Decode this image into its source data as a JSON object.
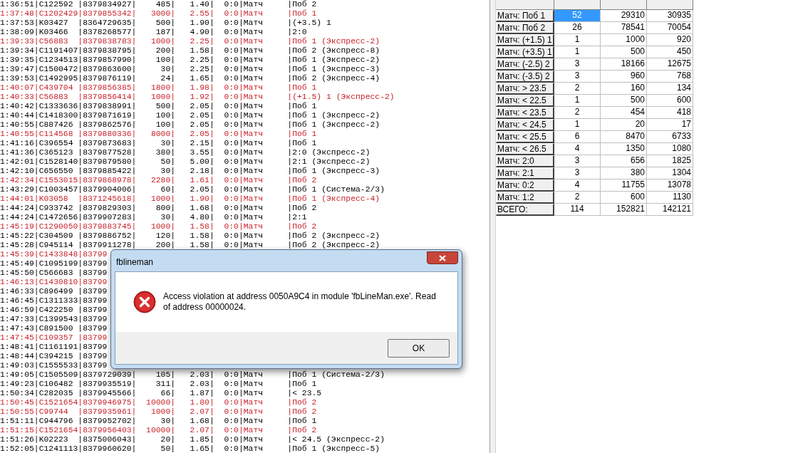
{
  "log": {
    "rows": [
      {
        "line": "1:36:51|C122592 |8379834927|    485|   1.40|  0:0|Матч     |Поб 2",
        "highlighted": false
      },
      {
        "line": "1:37:48|C1202429|8379855342|   3000|   2.55|  0:0|Матч     |Поб 1",
        "highlighted": true
      },
      {
        "line": "1:37:53|K03427  |8364729635|    500|   1.90|  0:0|Матч     |(+3.5) 1",
        "highlighted": false
      },
      {
        "line": "1:38:09|K03466  |8378268577|    187|   4.90|  0:0|Матч     |2:0",
        "highlighted": false
      },
      {
        "line": "1:39:33|C56883  |8379838783|   1000|   2.25|  0:0|Матч     |Поб 1 (Экспресс-2)",
        "highlighted": true
      },
      {
        "line": "1:39:34|C1191407|8379838795|    200|   1.58|  0:0|Матч     |Поб 2 (Экспресс-8)",
        "highlighted": false
      },
      {
        "line": "1:39:35|C1234513|8379857990|    100|   2.25|  0:0|Матч     |Поб 1 (Экспресс-2)",
        "highlighted": false
      },
      {
        "line": "1:39:47|C1500472|8379863600|     30|   2.25|  0:0|Матч     |Поб 1 (Экспресс-3)",
        "highlighted": false
      },
      {
        "line": "1:39:53|C1492995|8379876119|     24|   1.65|  0:0|Матч     |Поб 2 (Экспресс-4)",
        "highlighted": false
      },
      {
        "line": "1:40:07|C439704 |8379856385|   1800|   1.98|  0:0|Матч     |Поб 1",
        "highlighted": true
      },
      {
        "line": "1:40:33|C56883  |8379856414|   1000|   1.92|  0:0|Матч     |(+1.5) 1 (Экспресс-2)",
        "highlighted": true
      },
      {
        "line": "1:40:42|C1333636|8379838991|    500|   2.05|  0:0|Матч     |Поб 1",
        "highlighted": false
      },
      {
        "line": "1:40:44|C1418300|8379871619|    100|   2.05|  0:0|Матч     |Поб 1 (Экспресс-2)",
        "highlighted": false
      },
      {
        "line": "1:40:55|C887426 |8379862576|    100|   2.05|  0:0|Матч     |Поб 1 (Экспресс-2)",
        "highlighted": false
      },
      {
        "line": "1:40:55|C114568 |8379880336|   8000|   2.05|  0:0|Матч     |Поб 1",
        "highlighted": true
      },
      {
        "line": "1:41:16|C396554 |8379873683|     30|   2.15|  0:0|Матч     |Поб 1",
        "highlighted": false
      },
      {
        "line": "1:41:36|C365123 |8379877528|    380|   3.55|  0:0|Матч     |2:0 (Экспресс-2)",
        "highlighted": false
      },
      {
        "line": "1:42:01|C1528140|8379879580|     50|   5.00|  0:0|Матч     |2:1 (Экспресс-2)",
        "highlighted": false
      },
      {
        "line": "1:42:10|C656550 |8379885422|     30|   2.18|  0:0|Матч     |Поб 1 (Экспресс-3)",
        "highlighted": false
      },
      {
        "line": "1:42:34|C1553015|8379868978|   2280|   1.61|  0:0|Матч     |Поб 2",
        "highlighted": true
      },
      {
        "line": "1:43:29|C1003457|8379904006|     60|   2.05|  0:0|Матч     |Поб 1 (Система-2/3)",
        "highlighted": false
      },
      {
        "line": "1:44:01|K03058  |8371245618|   1000|   1.90|  0:0|Матч     |Поб 1 (Экспресс-4)",
        "highlighted": true
      },
      {
        "line": "1:44:24|C933742 |8379829303|    800|   1.68|  0:0|Матч     |Поб 2",
        "highlighted": false
      },
      {
        "line": "1:44:24|C1472656|8379907283|     30|   4.80|  0:0|Матч     |2:1",
        "highlighted": false
      },
      {
        "line": "1:45:19|C1290050|8379883745|   1000|   1.58|  0:0|Матч     |Поб 2",
        "highlighted": true
      },
      {
        "line": "1:45:22|C304509 |8379886752|    120|   1.58|  0:0|Матч     |Поб 2 (Экспресс-2)",
        "highlighted": false
      },
      {
        "line": "1:45:28|C945114 |8379911278|    200|   1.58|  0:0|Матч     |Поб 2 (Экспресс-2)",
        "highlighted": false
      },
      {
        "line": "1:45:39|C1433848|83799",
        "highlighted": true
      },
      {
        "line": "1:45:49|C1095199|83799",
        "highlighted": false
      },
      {
        "line": "1:45:50|C566683 |83799",
        "highlighted": false
      },
      {
        "line": "1:46:13|C1430810|83799",
        "highlighted": true
      },
      {
        "line": "1:46:33|C896499 |83799",
        "highlighted": false
      },
      {
        "line": "1:46:45|C1311333|83799",
        "highlighted": false
      },
      {
        "line": "1:46:59|C422250 |83799",
        "highlighted": false
      },
      {
        "line": "1:47:33|C1399543|83799",
        "highlighted": false
      },
      {
        "line": "1:47:43|C891500 |83799",
        "highlighted": false
      },
      {
        "line": "1:47:45|C109357 |83799",
        "highlighted": true
      },
      {
        "line": "1:48:41|C1161191|83799",
        "highlighted": false
      },
      {
        "line": "1:48:44|C394215 |83799",
        "highlighted": false
      },
      {
        "line": "1:49:03|C1555533|83799",
        "highlighted": false
      },
      {
        "line": "1:49:05|C1505509|8379729039|    105|   2.03|  0:0|Матч     |Поб 1 (Система-2/3)",
        "highlighted": false
      },
      {
        "line": "1:49:23|C106482 |8379935519|    311|   2.03|  0:0|Матч     |Поб 1",
        "highlighted": false
      },
      {
        "line": "1:50:34|C282035 |8379945566|     66|   1.87|  0:0|Матч     |< 23.5",
        "highlighted": false
      },
      {
        "line": "1:50:45|C1521654|8379946975|  10000|   1.80|  0:0|Матч     |Поб 2",
        "highlighted": true
      },
      {
        "line": "1:50:55|C99744  |8379935961|   1000|   2.07|  0:0|Матч     |Поб 2",
        "highlighted": true
      },
      {
        "line": "1:51:11|C944796 |8379952702|     30|   1.68|  0:0|Матч     |Поб 1",
        "highlighted": false
      },
      {
        "line": "1:51:15|C1521654|8379956403|  10000|   2.07|  0:0|Матч     |Поб 2",
        "highlighted": true
      },
      {
        "line": "1:51:26|K02223  |8375006043|     20|   1.85|  0:0|Матч     |< 24.5 (Экспресс-2)",
        "highlighted": false
      },
      {
        "line": "1:52:05|C1241113|8379960620|     50|   1.65|  0:0|Матч     |Поб 1 (Экспресс-5)",
        "highlighted": false
      }
    ]
  },
  "stats_table": {
    "rows": [
      {
        "label": "Матч: Поб 1",
        "cells": [
          "52",
          "29310",
          "30935"
        ],
        "selected": true
      },
      {
        "label": "Матч: Поб 2",
        "cells": [
          "26",
          "78541",
          "70054"
        ],
        "selected": false
      },
      {
        "label": "Матч: (+1.5) 1",
        "cells": [
          "1",
          "1000",
          "920"
        ],
        "selected": false
      },
      {
        "label": "Матч: (+3.5) 1",
        "cells": [
          "1",
          "500",
          "450"
        ],
        "selected": false
      },
      {
        "label": "Матч: (-2.5) 2",
        "cells": [
          "3",
          "18166",
          "12675"
        ],
        "selected": false
      },
      {
        "label": "Матч: (-3.5) 2",
        "cells": [
          "3",
          "960",
          "768"
        ],
        "selected": false
      },
      {
        "label": "Матч: > 23.5",
        "cells": [
          "2",
          "160",
          "134"
        ],
        "selected": false
      },
      {
        "label": "Матч: < 22.5",
        "cells": [
          "1",
          "500",
          "600"
        ],
        "selected": false
      },
      {
        "label": "Матч: < 23.5",
        "cells": [
          "2",
          "454",
          "418"
        ],
        "selected": false
      },
      {
        "label": "Матч: < 24.5",
        "cells": [
          "1",
          "20",
          "17"
        ],
        "selected": false
      },
      {
        "label": "Матч: < 25.5",
        "cells": [
          "6",
          "8470",
          "6733"
        ],
        "selected": false
      },
      {
        "label": "Матч: < 26.5",
        "cells": [
          "4",
          "1350",
          "1080"
        ],
        "selected": false
      },
      {
        "label": "Матч: 2:0",
        "cells": [
          "3",
          "656",
          "1825"
        ],
        "selected": false
      },
      {
        "label": "Матч: 2:1",
        "cells": [
          "3",
          "380",
          "1304"
        ],
        "selected": false
      },
      {
        "label": "Матч: 0:2",
        "cells": [
          "4",
          "11755",
          "13078"
        ],
        "selected": false
      },
      {
        "label": "Матч: 1:2",
        "cells": [
          "2",
          "600",
          "1130"
        ],
        "selected": false
      },
      {
        "label": "ВСЕГО:",
        "cells": [
          "114",
          "152821",
          "142121"
        ],
        "selected": false
      }
    ]
  },
  "dialog": {
    "title": "fblineman",
    "message": "Access violation at address 0050A9C4 in module 'fbLineMan.exe'. Read of address 00000024.",
    "buttons": [
      "OK"
    ]
  }
}
